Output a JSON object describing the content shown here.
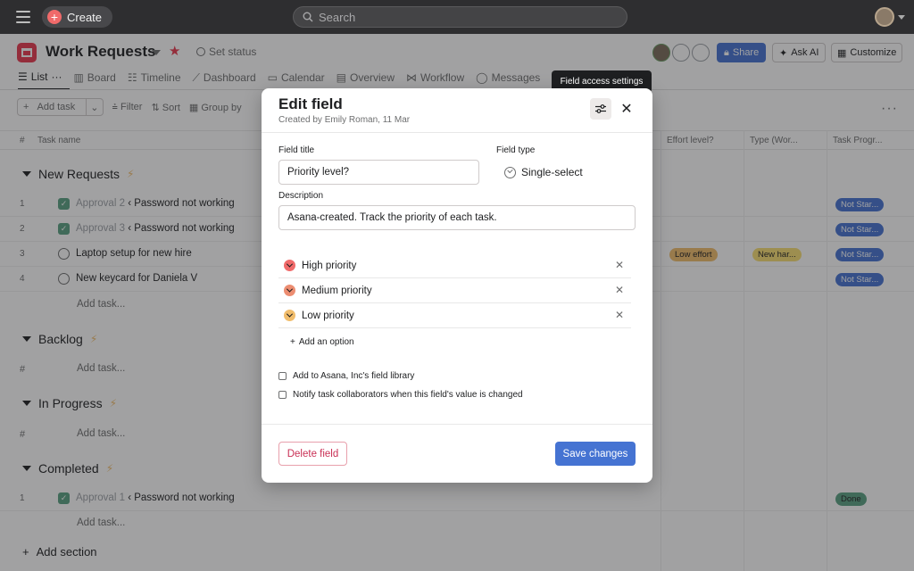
{
  "topbar": {
    "create_label": "Create",
    "search_placeholder": "Search"
  },
  "project": {
    "title": "Work Requests",
    "set_status": "Set status",
    "share_label": "Share",
    "ask_ai_label": "Ask AI",
    "customize_label": "Customize"
  },
  "tabs": [
    "List",
    "Board",
    "Timeline",
    "Dashboard",
    "Calendar",
    "Overview",
    "Workflow",
    "Messages"
  ],
  "toolbar": {
    "add_task": "Add task",
    "filter": "Filter",
    "sort": "Sort",
    "group_by": "Group by"
  },
  "columns": {
    "num": "#",
    "task_name": "Task name",
    "effort": "Effort level?",
    "type": "Type (Wor...",
    "progress": "Task Progr..."
  },
  "sections": {
    "new_requests": "New Requests",
    "backlog": "Backlog",
    "in_progress": "In Progress",
    "completed": "Completed",
    "add_section": "Add section",
    "add_task": "Add task...",
    "hash": "#"
  },
  "rows": [
    {
      "num": "1",
      "muted": "Approval 2",
      "name": "‹ Password not working",
      "progress": "Not Star..."
    },
    {
      "num": "2",
      "muted": "Approval 3",
      "name": "‹ Password not working",
      "progress": "Not Star..."
    },
    {
      "num": "3",
      "name": "Laptop setup for new hire",
      "effort": "Low effort",
      "type": "New har...",
      "progress": "Not Star..."
    },
    {
      "num": "4",
      "name": "New keycard for Daniela V",
      "progress": "Not Star..."
    }
  ],
  "completed_row": {
    "num": "1",
    "muted": "Approval 1",
    "name": "‹ Password not working",
    "progress": "Done"
  },
  "modal": {
    "title": "Edit field",
    "subtitle": "Created by Emily Roman, 11 Mar",
    "field_title_label": "Field title",
    "field_title_value": "Priority level?",
    "field_type_label": "Field type",
    "field_type_value": "Single-select",
    "description_label": "Description",
    "description_value": "Asana-created. Track the priority of each task.",
    "options": [
      {
        "label": "High priority",
        "color": "#f06a6a"
      },
      {
        "label": "Medium priority",
        "color": "#ec8d71"
      },
      {
        "label": "Low priority",
        "color": "#f1bd6c"
      }
    ],
    "add_option": "Add an option",
    "checkbox_library": "Add to Asana, Inc's field library",
    "checkbox_notify": "Notify task collaborators when this field's value is changed",
    "delete_label": "Delete field",
    "save_label": "Save changes"
  },
  "tooltip": "Field access settings",
  "colors": {
    "accent": "#4573d2",
    "danger": "#c92f54",
    "topbar": "#2e2e30"
  }
}
